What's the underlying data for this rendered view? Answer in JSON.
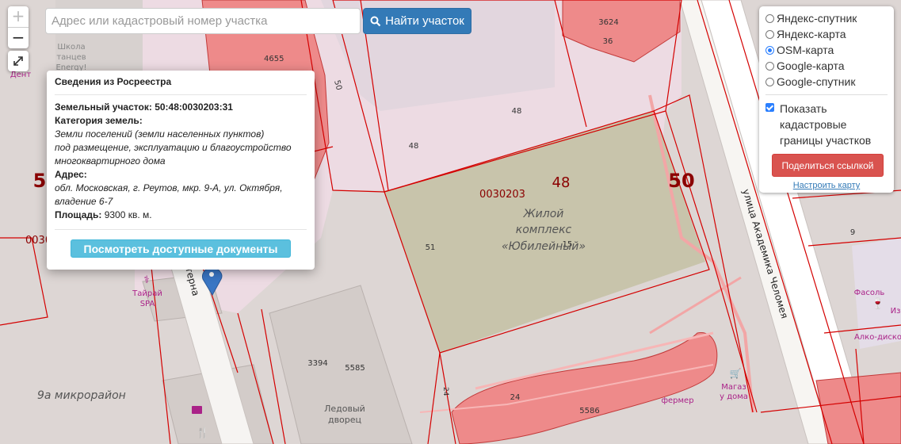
{
  "colors": {
    "accent": "#337ab7",
    "cadastral_border": "#d40000",
    "parcel_fill": "#ee8a8a",
    "complex_fill": "#c8c4ab",
    "danger": "#d9534f",
    "info": "#5bc0de"
  },
  "map": {
    "street_name": "улица Академика Челомея",
    "street_partial": "терна",
    "district_label": "9а микрорайон",
    "complex_label": [
      "Жилой",
      "комплекс",
      "«Юбилейный»"
    ],
    "cadastral_block": "0030203",
    "cadastral_block_left": "0030",
    "big_numbers": {
      "center": "48",
      "right": "50",
      "left": "5"
    },
    "parcel_numbers": {
      "n4655": "4655",
      "n3624": "3624",
      "n36": "36",
      "n50": "50",
      "n48a": "48",
      "n48b": "48",
      "n51": "51",
      "n15": "15",
      "n3394": "3394",
      "n5585": "5585",
      "n5586": "5586",
      "n24": "24",
      "n24b": "24",
      "n9": "9"
    },
    "poi": {
      "school": [
        "Школа",
        "танцев",
        "Energy!"
      ],
      "dent": "Дент",
      "spa": [
        "Тайрай",
        "SPA"
      ],
      "ice": [
        "Ледовый",
        "дворец"
      ],
      "fasol": "Фасоль",
      "alko": "Алко-диско",
      "iz": "Из",
      "magazin": [
        "Магаз",
        "у дома"
      ],
      "fermer": "фермер"
    }
  },
  "zoom": {
    "in_label": "+",
    "out_label": "−"
  },
  "search": {
    "placeholder": "Адрес или кадастровый номер участка",
    "button_label": "Найти участок"
  },
  "popup": {
    "title": "Сведения из Росреестра",
    "parcel_label": "Земельный участок:",
    "parcel_number": "50:48:0030203:31",
    "category_label": "Категория земель:",
    "category_value": "Земли поселений (земли населенных пунктов)",
    "usage_value": "под размещение, эксплуатацию и благоустройство многоквартирного дома",
    "address_label": "Адрес:",
    "address_value": "обл. Московская, г. Реутов, мкр. 9-А, ул. Октября, владение 6-7",
    "area_label": "Площадь:",
    "area_value": "9300 кв. м.",
    "docs_button": "Посмотреть доступные документы"
  },
  "layers": {
    "options": [
      {
        "label": "Яндекс-спутник",
        "selected": false
      },
      {
        "label": "Яндекс-карта",
        "selected": false
      },
      {
        "label": "OSM-карта",
        "selected": true
      },
      {
        "label": "Google-карта",
        "selected": false
      },
      {
        "label": "Google-спутник",
        "selected": false
      }
    ],
    "show_borders_label": "Показать кадастровые границы участков",
    "show_borders_checked": true,
    "share_button": "Поделиться ссылкой",
    "configure_link": "Настроить карту"
  }
}
